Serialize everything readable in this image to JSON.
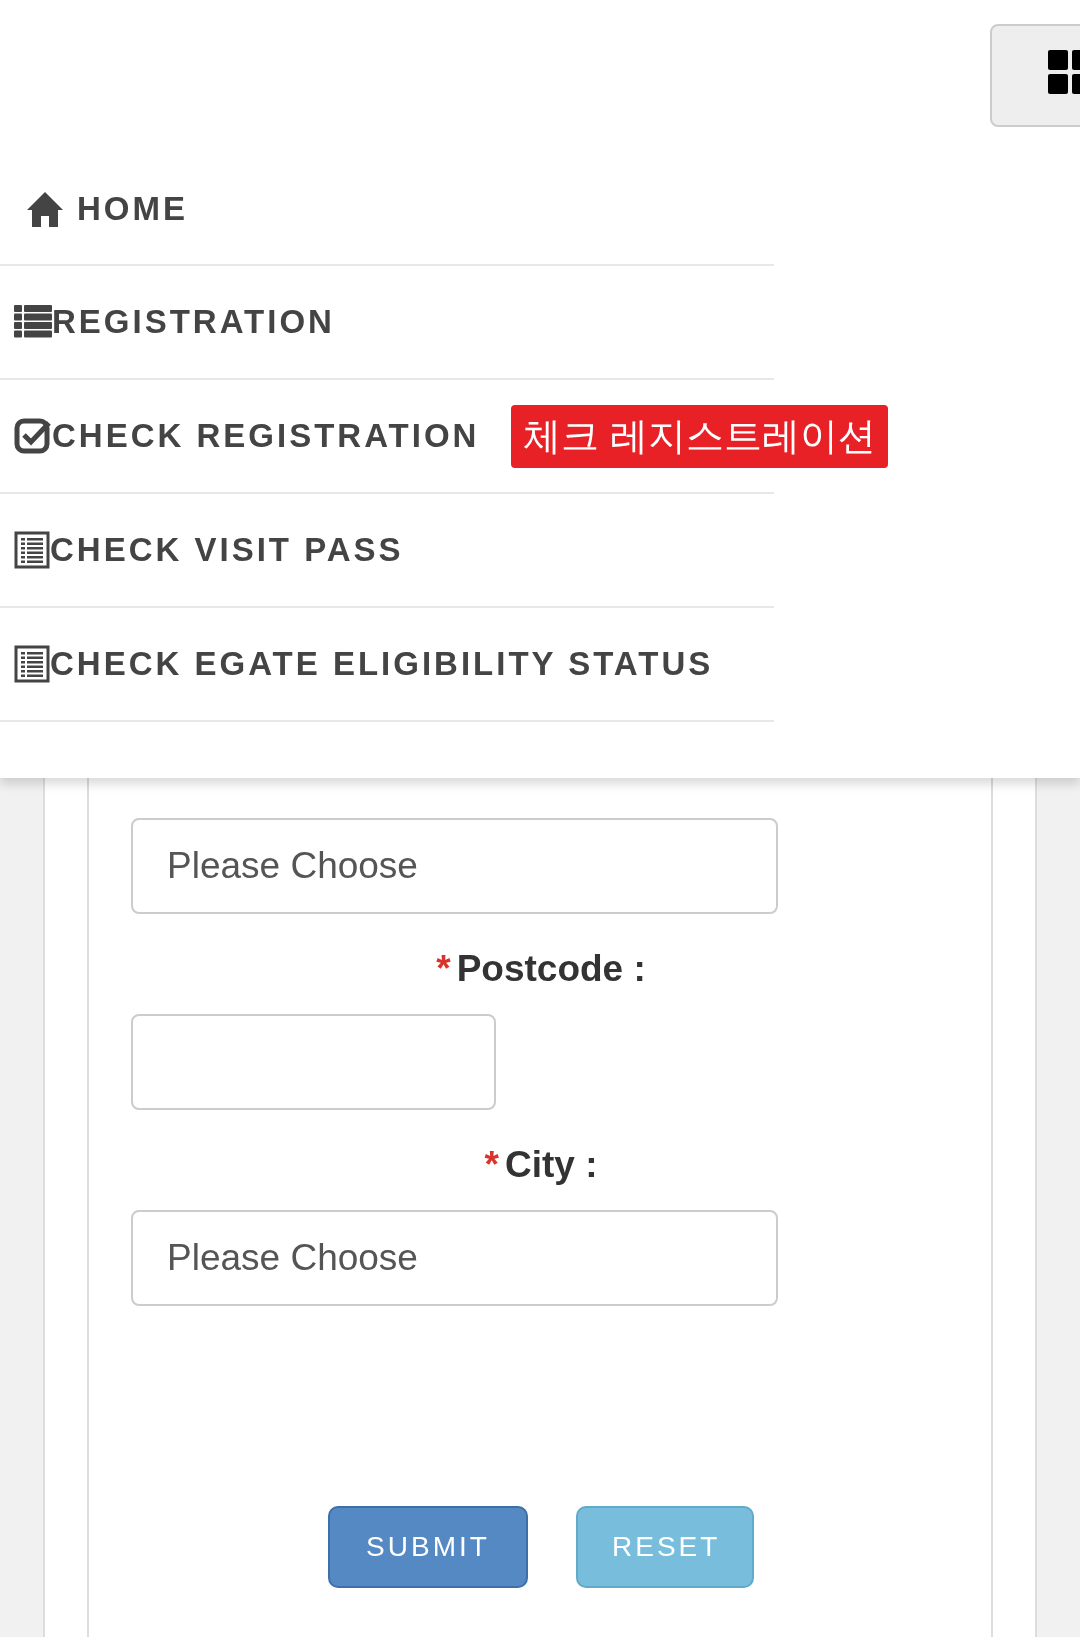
{
  "menu": {
    "items": [
      {
        "label": "HOME",
        "kind": "home"
      },
      {
        "label": "REGISTRATION",
        "kind": "list"
      },
      {
        "label": "CHECK REGISTRATION",
        "kind": "check",
        "badge": "체크 레지스트레이션"
      },
      {
        "label": "CHECK VISIT PASS",
        "kind": "doc"
      },
      {
        "label": "CHECK EGATE ELIGIBILITY STATUS",
        "kind": "doc"
      }
    ]
  },
  "form": {
    "fields": [
      {
        "kind": "select",
        "placeholder": "Please Choose"
      },
      {
        "mark": "*",
        "label": "Postcode :",
        "kind": "text"
      },
      {
        "mark": "*",
        "label": "City :",
        "kind": "select",
        "placeholder": "Please Choose"
      }
    ],
    "buttons": [
      {
        "label": "SUBMIT",
        "kind": "primary"
      },
      {
        "label": "RESET",
        "kind": "info"
      }
    ]
  }
}
